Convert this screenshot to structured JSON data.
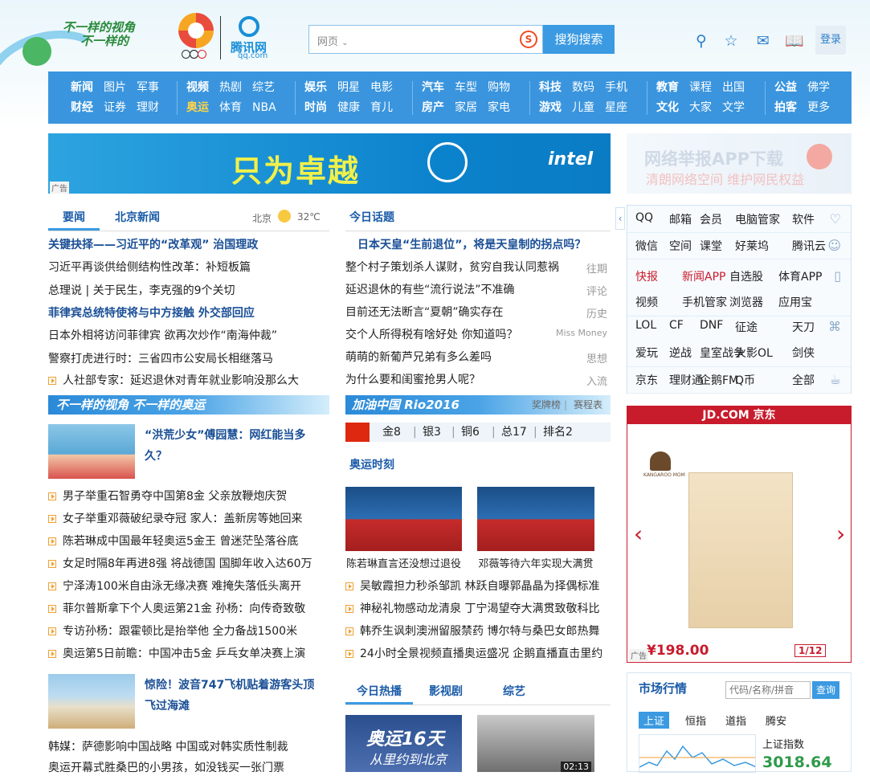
{
  "header": {
    "slogan_line1": "不一样的视角",
    "slogan_line2": "不一样的",
    "logo_name": "腾讯网",
    "logo_domain": "qq.com",
    "search": {
      "scope": "网页",
      "engine_mark": "S",
      "button": "搜狗搜索"
    },
    "icons": [
      "navigator-icon",
      "star-icon",
      "mail-icon",
      "book-icon"
    ],
    "login": "登录"
  },
  "nav": {
    "groups": [
      {
        "row1": [
          [
            "新闻",
            "b"
          ],
          [
            "图片",
            ""
          ],
          [
            "军事",
            ""
          ]
        ],
        "row2": [
          [
            "财经",
            "b"
          ],
          [
            "证券",
            ""
          ],
          [
            "理财",
            ""
          ]
        ]
      },
      {
        "row1": [
          [
            "视频",
            "b"
          ],
          [
            "热剧",
            ""
          ],
          [
            "综艺",
            ""
          ]
        ],
        "row2": [
          [
            "奥运",
            "hl"
          ],
          [
            "体育",
            ""
          ],
          [
            "NBA",
            ""
          ]
        ]
      },
      {
        "row1": [
          [
            "娱乐",
            "b"
          ],
          [
            "明星",
            ""
          ],
          [
            "电影",
            ""
          ]
        ],
        "row2": [
          [
            "时尚",
            "b"
          ],
          [
            "健康",
            ""
          ],
          [
            "育儿",
            ""
          ]
        ]
      },
      {
        "row1": [
          [
            "汽车",
            "b"
          ],
          [
            "车型",
            ""
          ],
          [
            "购物",
            ""
          ]
        ],
        "row2": [
          [
            "房产",
            "b"
          ],
          [
            "家居",
            ""
          ],
          [
            "家电",
            ""
          ]
        ]
      },
      {
        "row1": [
          [
            "科技",
            "b"
          ],
          [
            "数码",
            ""
          ],
          [
            "手机",
            ""
          ]
        ],
        "row2": [
          [
            "游戏",
            "b"
          ],
          [
            "儿童",
            ""
          ],
          [
            "星座",
            ""
          ]
        ]
      },
      {
        "row1": [
          [
            "教育",
            "b"
          ],
          [
            "课程",
            ""
          ],
          [
            "出国",
            ""
          ]
        ],
        "row2": [
          [
            "文化",
            "b"
          ],
          [
            "大家",
            ""
          ],
          [
            "文学",
            ""
          ]
        ]
      },
      {
        "row1": [
          [
            "公益",
            "b"
          ],
          [
            "佛学",
            ""
          ]
        ],
        "row2": [
          [
            "拍客",
            "b"
          ],
          [
            "更多",
            ""
          ]
        ]
      }
    ]
  },
  "ads": {
    "intel_text": "只为卓越",
    "intel_logo": "intel",
    "ad_tag": "广告",
    "app_title": "网络举报APP下载",
    "app_sub": "清朗网络空间  维护网民权益"
  },
  "left": {
    "tabs": [
      "要闻",
      "北京新闻"
    ],
    "weather": {
      "city": "北京",
      "temp": "32℃"
    },
    "headlines": [
      {
        "text": "关键抉择——习近平的“改革观”  治国理政",
        "bold": true
      },
      {
        "text": "习近平再谈供给侧结构性改革：补短板篇",
        "bold": false
      },
      {
        "text": "总理说 | 关于民生，李克强的9个关切",
        "bold": false
      },
      {
        "text": "菲律宾总统特使将与中方接触  外交部回应",
        "bold": true
      },
      {
        "text": "日本外相将访问菲律宾 欲再次炒作“南海仲裁”",
        "bold": false
      },
      {
        "text": "警察打虎进行时：三省四市公安局长相继落马",
        "bold": false
      }
    ],
    "item7": "人社部专家：延迟退休对青年就业影响没那么大",
    "banner": "不一样的视角  不一样的奥运",
    "feature1": "“洪荒少女”傅园慧：网红能当多久？",
    "list": [
      "男子举重石智勇夺中国第8金 父亲放鞭炮庆贺",
      "女子举重邓薇破纪录夺冠 家人：盖新房等她回来",
      "陈若琳成中国最年轻奥运5金王 曾迷茫坠落谷底",
      "女足时隔8年再进8强 将战德国 国脚年收入达60万",
      "宁泽涛100米自由泳无缘决赛 难掩失落低头离开",
      "菲尔普斯拿下个人奥运第21金 孙杨：向传奇致敬",
      "专访孙杨：跟霍顿比是抬举他 全力备战1500米",
      "奥运第5日前瞻：中国冲击5金 乒乓女单决赛上演"
    ],
    "feature2": "惊险！波音747飞机贴着游客头顶飞过海滩",
    "last1": "韩媒：萨德影响中国战略 中国或对韩实质性制裁",
    "last2": "奥运开幕式胜桑巴的小男孩，如没钱买一张门票"
  },
  "middle": {
    "tab": "今日话题",
    "topic": "日本天皇“生前退位”，将是天皇制的拐点吗？",
    "items": [
      {
        "text": "整个村子策划杀人谋财，贫穷自我认同惹祸",
        "cat": "往期"
      },
      {
        "text": "延迟退休的有些“流行说法”不准确",
        "cat": "评论"
      },
      {
        "text": "目前还无法断言“夏朝”确实存在",
        "cat": "历史"
      },
      {
        "text": "交个人所得税有啥好处 你知道吗？",
        "cat": "Miss Money"
      },
      {
        "text": "萌萌的新葡芦兄弟有多么差吗",
        "cat": "思想"
      },
      {
        "text": "为什么要和闺蜜抢男人呢？",
        "cat": "入流"
      }
    ],
    "banner": "加油中国 Rio2016",
    "banner_links": [
      "奖牌榜",
      "赛程表"
    ],
    "medals": {
      "gold": "金8",
      "silver": "银3",
      "bronze": "铜6",
      "total": "总17",
      "rank": "排名2"
    },
    "section": "奥运时刻",
    "photos": [
      "陈若琳直言还没想过退役",
      "邓薇等待六年实现大满贯"
    ],
    "list": [
      "吴敏霞担力秒杀邹凯 林跃自曝郭晶晶为择偶标准",
      "神秘礼物感动龙清泉 丁宁渴望夺大满贯致敬科比",
      "韩乔生讽刺澳洲留服禁药 博尔特与桑巴女郎热舞",
      "24小时全景视频直播奥运盛况 企鹅直播直击里约"
    ],
    "tabs2": [
      "今日热播",
      "影视剧",
      "综艺"
    ],
    "video1_text": "奥运16天",
    "video1_sub": "从里约到北京",
    "video2_time": "02:13"
  },
  "right": {
    "services": [
      [
        [
          "QQ",
          ""
        ],
        [
          "邮箱",
          ""
        ],
        [
          "会员",
          ""
        ],
        [
          "电脑管家",
          ""
        ],
        [
          "软件",
          ""
        ]
      ],
      [
        [
          "微信",
          ""
        ],
        [
          "空间",
          ""
        ],
        [
          "课堂",
          ""
        ],
        [
          "好莱坞",
          ""
        ],
        [
          "腾讯云",
          ""
        ]
      ],
      [
        [
          "快报",
          "red"
        ],
        [
          "新闻APP",
          "red"
        ],
        [
          "自选股",
          ""
        ],
        [
          "体育APP",
          ""
        ]
      ],
      [
        [
          "视频",
          ""
        ],
        [
          "手机管家",
          ""
        ],
        [
          "浏览器",
          ""
        ],
        [
          "应用宝",
          ""
        ]
      ],
      [
        [
          "LOL",
          ""
        ],
        [
          "CF",
          ""
        ],
        [
          "DNF",
          ""
        ],
        [
          "征途",
          ""
        ],
        [
          "天刀",
          ""
        ]
      ],
      [
        [
          "爱玩",
          ""
        ],
        [
          "逆战",
          ""
        ],
        [
          "皇室战争",
          ""
        ],
        [
          "火影OL",
          ""
        ],
        [
          "剑侠",
          ""
        ]
      ],
      [
        [
          "京东",
          ""
        ],
        [
          "理财通",
          ""
        ],
        [
          "企鹅FM",
          ""
        ],
        [
          "Q币",
          ""
        ],
        [
          "全部",
          ""
        ]
      ]
    ],
    "jd": {
      "header": "JD.COM 京东",
      "brand": "KANGAROO MOM",
      "price": "¥198.00",
      "page": "1/12",
      "ad_tag": "广告"
    },
    "market": {
      "title": "市场行情",
      "placeholder": "代码/名称/拼音",
      "button": "查询",
      "tabs": [
        "上证",
        "恒指",
        "道指",
        "腾安"
      ],
      "index_name": "上证指数",
      "index_value": "3018.64"
    }
  },
  "colors": {
    "nav_bg": "#3a95de",
    "link_blue": "#1a4f96",
    "accent_red": "#c81b2c"
  }
}
